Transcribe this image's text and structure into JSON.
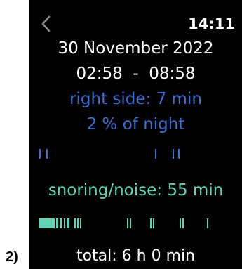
{
  "figure_label": "2)",
  "status_bar": {
    "back_icon": "chevron-left-icon",
    "time": "14:11"
  },
  "summary": {
    "date": "30 November 2022",
    "time_range": "02:58  -  08:58",
    "right_side": "right side: 7 min",
    "percent_of_night": "2 % of night",
    "snoring": "snoring/noise: 55 min",
    "total": "total: 6 h 0 min"
  },
  "colors": {
    "background": "#000000",
    "text": "#ffffff",
    "right_side": "#3d6fd0",
    "snoring": "#5fd3b6"
  }
}
